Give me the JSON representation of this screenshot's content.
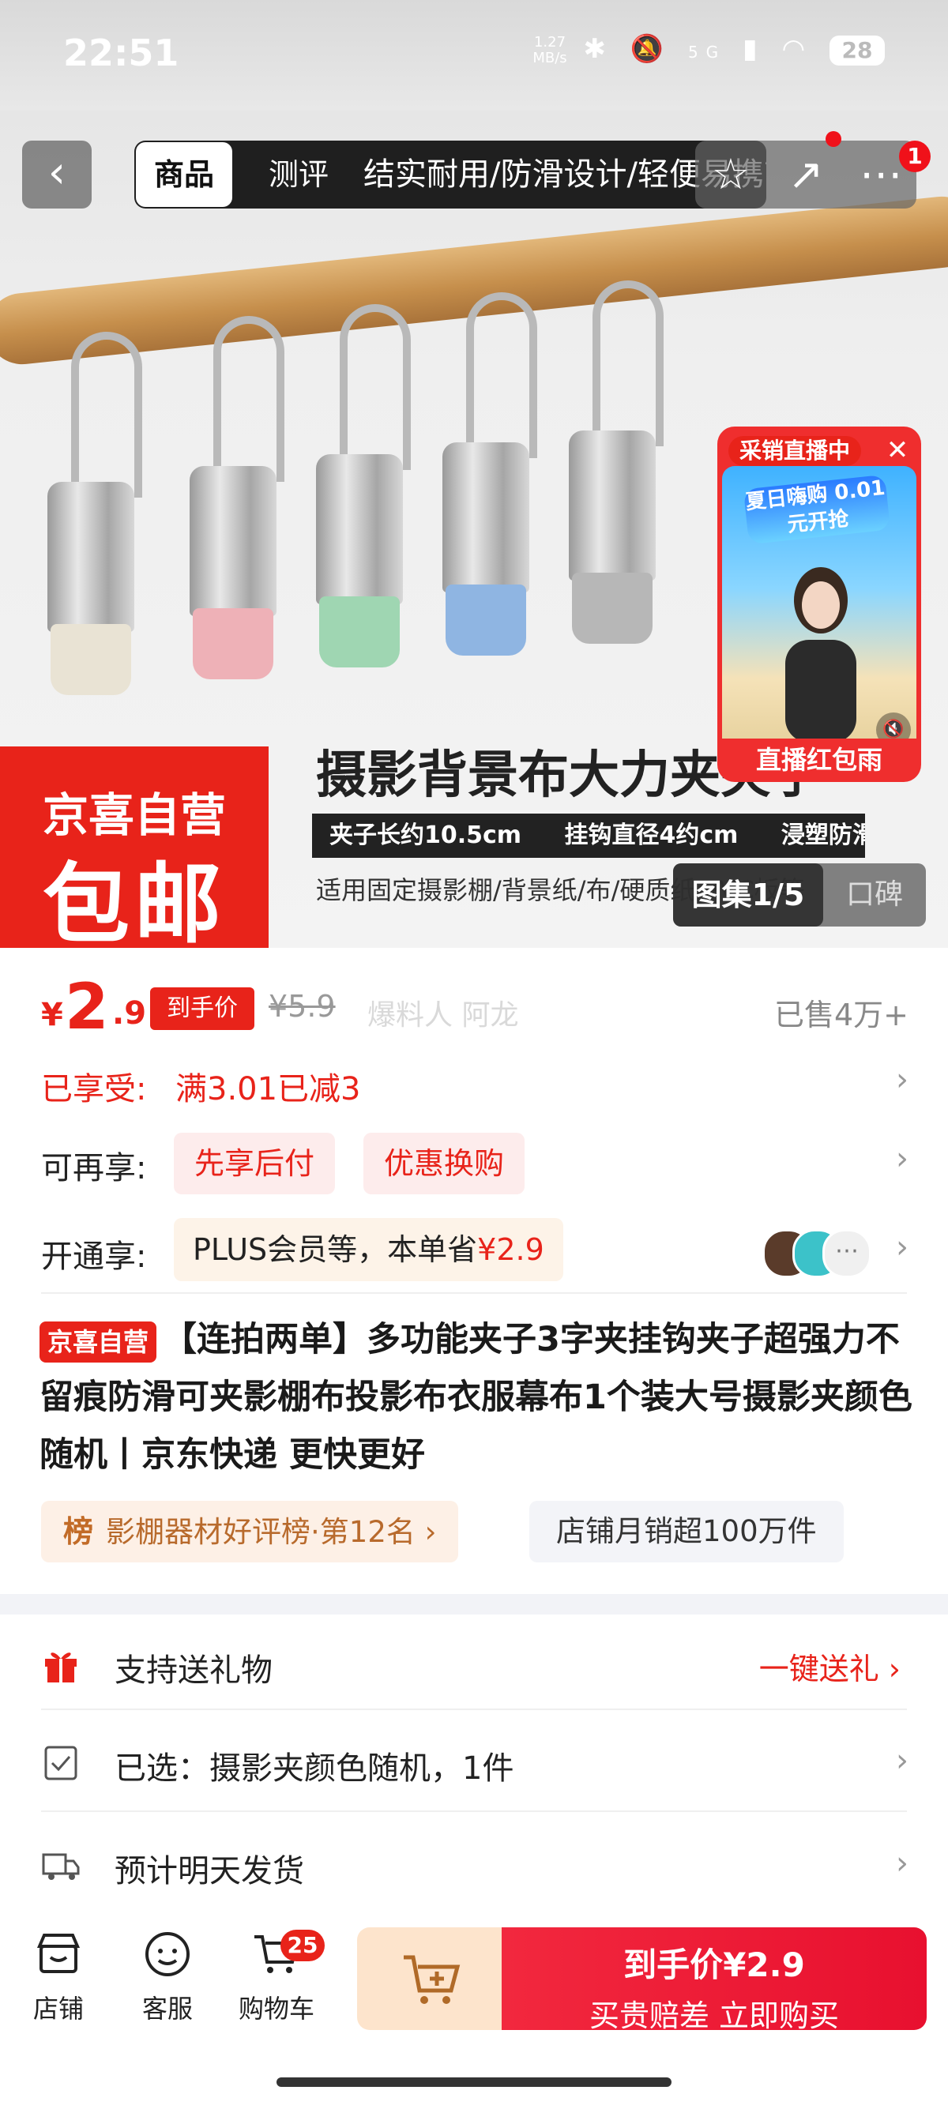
{
  "status_bar": {
    "time": "22:51",
    "net_speed_value": "1.27",
    "net_speed_unit": "MB/s",
    "network": "5G",
    "battery": "28"
  },
  "nav": {
    "tab_product": "商品",
    "tab_review": "测评",
    "banner_text": "结实耐用/防滑设计/轻便易携带",
    "more_badge": "1"
  },
  "hero": {
    "ribbon_line1": "京喜自营",
    "ribbon_line2": "包邮",
    "title": "摄影背景布大力夹夹子",
    "spec1": "夹子长约10.5cm",
    "spec2": "挂钩直径4约cm",
    "spec3": "浸塑防滑",
    "usage": "适用固定摄影棚/背景纸/布/硬质纸/PVC板等",
    "gallery_label": "图集1/5",
    "gallery_second": "口碑"
  },
  "live": {
    "tag": "采销直播中",
    "promo": "夏日嗨购 0.01元开抢",
    "footer": "直播红包雨"
  },
  "price": {
    "currency": "¥",
    "integer": "2",
    "decimal": ".9",
    "tag": "到手价",
    "original": "¥5.9",
    "watermark": "爆料人 阿龙",
    "sold": "已售4万+"
  },
  "promotions": {
    "enjoyed_label": "已享受:",
    "enjoyed_value": "满3.01已减3",
    "more_label": "可再享:",
    "pill1": "先享后付",
    "pill2": "优惠换购",
    "open_label": "开通享:",
    "plus_text": "PLUS会员等，本单省",
    "plus_amount": "¥2.9"
  },
  "product": {
    "badge": "京喜自营",
    "title": "【连拍两单】多功能夹子3字夹挂钩夹子超强力不留痕防滑可夹影棚布投影布衣服幕布1个装大号摄影夹颜色随机丨京东快递 更快更好",
    "rank_icon": "榜",
    "rank_text": "影棚器材好评榜·第12名",
    "monthly": "店铺月销超100万件"
  },
  "services": {
    "gift_label": "支持送礼物",
    "gift_action": "一键送礼",
    "selected_label": "已选：摄影夹颜色随机，1件",
    "ship_label": "预计明天发货"
  },
  "bottom": {
    "store": "店铺",
    "service": "客服",
    "cart": "购物车",
    "cart_count": "25",
    "buy_line1_prefix": "到手价",
    "buy_price": "¥2.9",
    "buy_line2": "买贵赔差 立即购买"
  },
  "colors": {
    "accent_red": "#e8231a",
    "buy_gradient_start": "#f2283e",
    "addcart_bg": "#fde4cc"
  }
}
